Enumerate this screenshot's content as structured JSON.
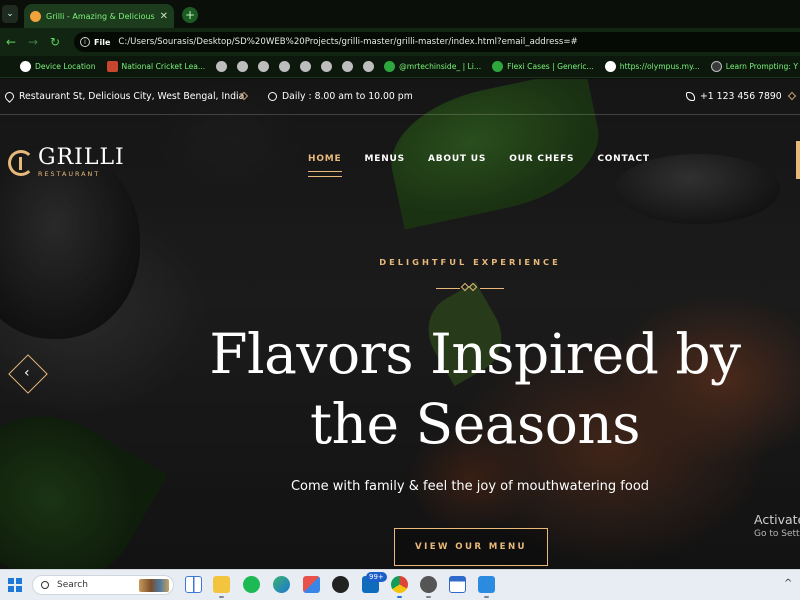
{
  "browser": {
    "tab": {
      "title": "Grilli - Amazing & Delicious Food",
      "close": "✕"
    },
    "new_tab": "+",
    "tab_menu": "⌄",
    "nav": {
      "back": "←",
      "forward": "→",
      "reload": "↻"
    },
    "address": {
      "scheme_chip": "File",
      "url": "C:/Users/Sourasis/Desktop/SD%20WEB%20Projects/grilli-master/grilli-master/index.html?email_address=#"
    },
    "bookmarks": [
      {
        "label": "Device Location"
      },
      {
        "label": "National Cricket Lea..."
      },
      {
        "label": "@mrtechinside_ | Li..."
      },
      {
        "label": "Flexi Cases | Generic..."
      },
      {
        "label": "https://olympus.my..."
      },
      {
        "label": "Learn Prompting: Y"
      }
    ]
  },
  "site": {
    "topbar": {
      "address": "Restaurant St, Delicious City, West Bengal, India",
      "hours": "Daily : 8.00 am to 10.00 pm",
      "phone": "+1 123 456 7890"
    },
    "logo": {
      "name": "GRILLI",
      "tagline": "RESTAURANT"
    },
    "nav": [
      {
        "label": "HOME",
        "active": true
      },
      {
        "label": "MENUS"
      },
      {
        "label": "ABOUT US"
      },
      {
        "label": "OUR CHEFS"
      },
      {
        "label": "CONTACT"
      }
    ],
    "hero": {
      "eyebrow": "DELIGHTFUL EXPERIENCE",
      "title_line1": "Flavors Inspired by",
      "title_line2": "the Seasons",
      "subtitle": "Come with family & feel the joy of mouthwatering food",
      "cta": "VIEW OUR MENU",
      "prev": "‹"
    },
    "accent_color": "#e8b97b"
  },
  "watermark": {
    "title": "Activate",
    "subtitle": "Go to Sett"
  },
  "taskbar": {
    "search_placeholder": "Search",
    "badge": "99+",
    "tray_chevron": "^"
  }
}
